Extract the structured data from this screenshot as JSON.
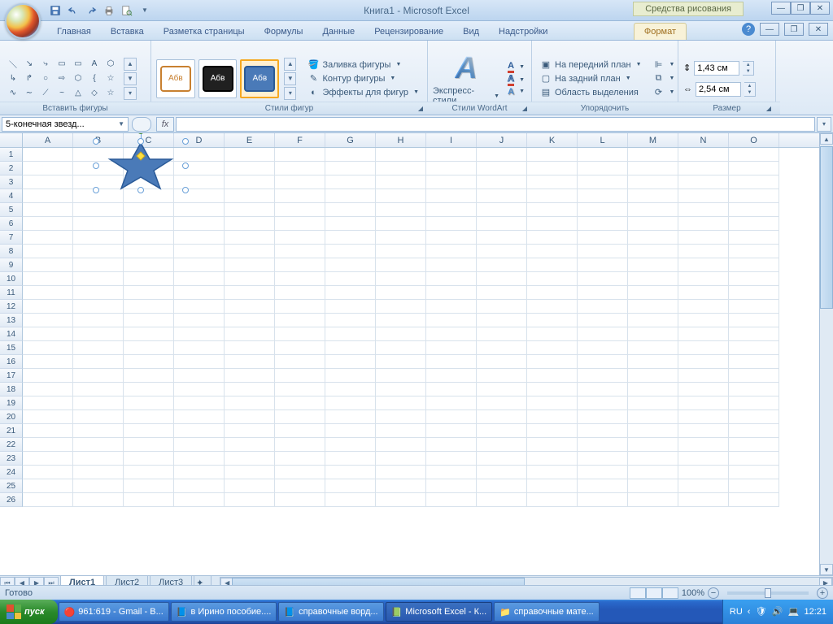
{
  "title": "Книга1 - Microsoft Excel",
  "context_tab": "Средства рисования",
  "tabs": [
    "Главная",
    "Вставка",
    "Разметка страницы",
    "Формулы",
    "Данные",
    "Рецензирование",
    "Вид",
    "Надстройки",
    "Формат"
  ],
  "active_tab": "Формат",
  "groups": {
    "insert_shapes": "Вставить фигуры",
    "shape_styles": "Стили фигур",
    "wordart_styles": "Стили WordArt",
    "arrange": "Упорядочить",
    "size": "Размер"
  },
  "shape_fill": "Заливка фигуры",
  "shape_outline": "Контур фигуры",
  "shape_effects": "Эффекты для фигур",
  "style_sample": "Абв",
  "quick_styles": "Экспресс-стили",
  "bring_front": "На передний план",
  "send_back": "На задний план",
  "selection_pane": "Область выделения",
  "height": "1,43 см",
  "width": "2,54 см",
  "name_box": "5-конечная звезд...",
  "columns": [
    "A",
    "B",
    "C",
    "D",
    "E",
    "F",
    "G",
    "H",
    "I",
    "J",
    "K",
    "L",
    "M",
    "N",
    "O"
  ],
  "row_count": 26,
  "sheets": [
    "Лист1",
    "Лист2",
    "Лист3"
  ],
  "active_sheet": "Лист1",
  "status_text": "Готово",
  "zoom": "100%",
  "start": "пуск",
  "task_items": [
    "961:619 - Gmail - В...",
    "в Ирино пособие....",
    "справочные ворд...",
    "Microsoft Excel - К...",
    "справочные мате..."
  ],
  "lang": "RU",
  "clock": "12:21"
}
